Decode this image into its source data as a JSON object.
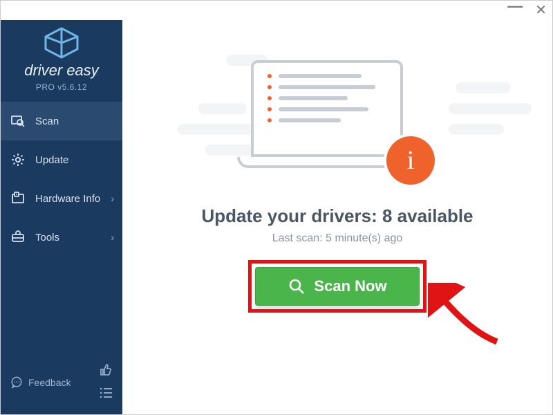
{
  "brand": {
    "name": "driver easy",
    "version": "PRO v5.6.12"
  },
  "sidebar": {
    "items": [
      {
        "label": "Scan"
      },
      {
        "label": "Update"
      },
      {
        "label": "Hardware Info"
      },
      {
        "label": "Tools"
      }
    ],
    "feedback": "Feedback"
  },
  "main": {
    "headline": "Update your drivers: 8 available",
    "subline": "Last scan: 5 minute(s) ago",
    "scan_button": "Scan Now"
  }
}
